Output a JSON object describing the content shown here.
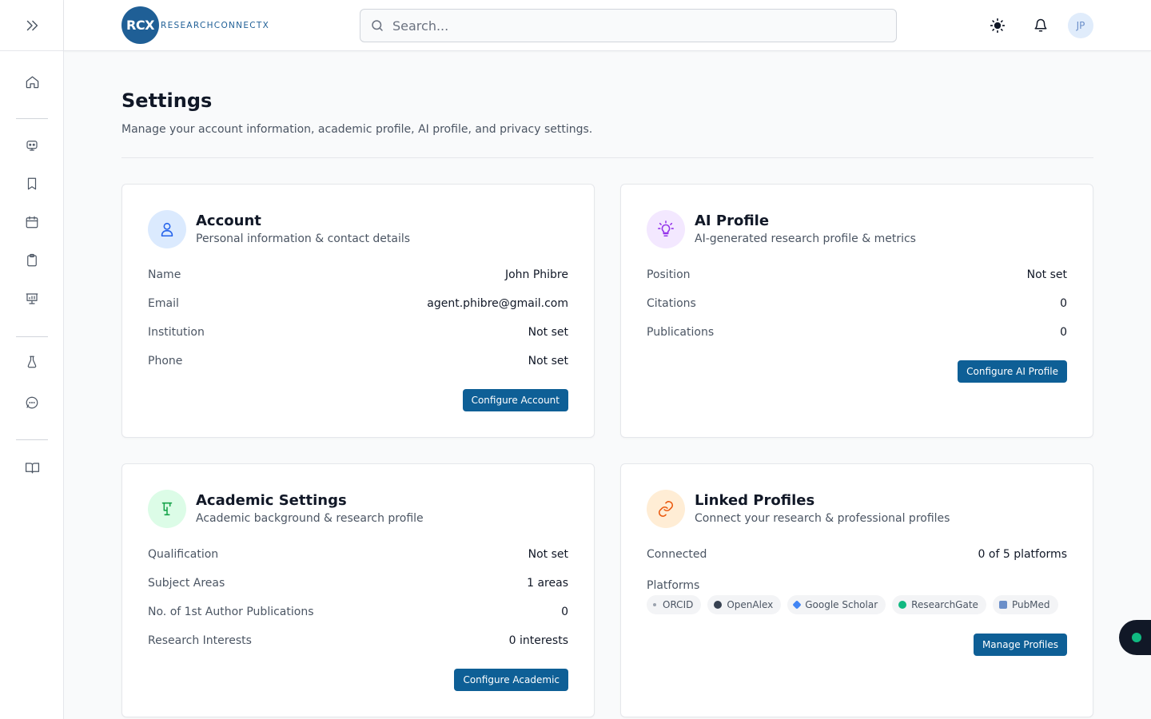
{
  "header": {
    "logo_initials": "RCX",
    "logo_wordmark": "RESEARCHCONNECTX",
    "search_placeholder": "Search...",
    "avatar_initials": "JP"
  },
  "sidebar": {
    "items": [
      {
        "icon": "home-icon"
      },
      {
        "icon": "bot-icon"
      },
      {
        "icon": "bookmark-icon"
      },
      {
        "icon": "calendar-icon"
      },
      {
        "icon": "clipboard-icon"
      },
      {
        "icon": "presentation-icon"
      },
      {
        "icon": "flask-icon"
      },
      {
        "icon": "message-circle-icon"
      },
      {
        "icon": "book-open-icon"
      }
    ]
  },
  "page": {
    "title": "Settings",
    "subtitle": "Manage your account information, academic profile, AI profile, and privacy settings."
  },
  "cards": {
    "account": {
      "title": "Account",
      "desc": "Personal information & contact details",
      "rows": [
        {
          "k": "Name",
          "v": "John Phibre"
        },
        {
          "k": "Email",
          "v": "agent.phibre@gmail.com"
        },
        {
          "k": "Institution",
          "v": "Not set"
        },
        {
          "k": "Phone",
          "v": "Not set"
        }
      ],
      "button": "Configure Account"
    },
    "ai": {
      "title": "AI Profile",
      "desc": "AI-generated research profile & metrics",
      "rows": [
        {
          "k": "Position",
          "v": "Not set"
        },
        {
          "k": "Citations",
          "v": "0"
        },
        {
          "k": "Publications",
          "v": "0"
        }
      ],
      "button": "Configure AI Profile"
    },
    "academic": {
      "title": "Academic Settings",
      "desc": "Academic background & research profile",
      "rows": [
        {
          "k": "Qualification",
          "v": "Not set"
        },
        {
          "k": "Subject Areas",
          "v": "1 areas"
        },
        {
          "k": "No. of 1st Author Publications",
          "v": "0"
        },
        {
          "k": "Research Interests",
          "v": "0 interests"
        }
      ],
      "button": "Configure Academic"
    },
    "linked": {
      "title": "Linked Profiles",
      "desc": "Connect your research & professional profiles",
      "rows": [
        {
          "k": "Connected",
          "v": "0 of 5 platforms"
        }
      ],
      "platforms_label": "Platforms",
      "platforms": [
        "ORCID",
        "OpenAlex",
        "Google Scholar",
        "ResearchGate",
        "PubMed"
      ],
      "button": "Manage Profiles"
    }
  },
  "colors": {
    "primary": "#0e5f96",
    "account_icon_bg": "#dbeafe",
    "ai_icon_bg": "#f3e8ff",
    "academic_icon_bg": "#dcfce7",
    "linked_icon_bg": "#ffedd5",
    "status_dot": "#10b981"
  }
}
